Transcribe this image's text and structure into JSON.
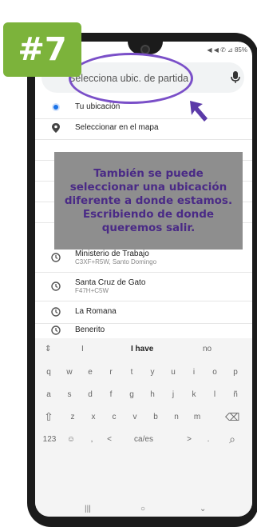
{
  "badge": "#7",
  "status": "◀ ◀ ✆ ⊿ 85%",
  "search": {
    "placeholder": "Selecciona ubic. de partida"
  },
  "rows": [
    {
      "title": "Tu ubicación",
      "sub": "",
      "icon": "location-dot-icon"
    },
    {
      "title": "Seleccionar en el mapa",
      "sub": "",
      "icon": "map-pin-icon"
    },
    {
      "title": "Ministerio de Trabajo",
      "sub": "C3XF+R5W, Santo Domingo",
      "icon": "history-icon"
    },
    {
      "title": "Santa Cruz de Gato",
      "sub": "F47H+C5W",
      "icon": "history-icon"
    },
    {
      "title": "La Romana",
      "sub": "",
      "icon": "history-icon"
    },
    {
      "title": "Benerito",
      "sub": "",
      "icon": "history-icon"
    }
  ],
  "overlay_text": "También se puede seleccionar una ubicación diferente a donde estamos. Escribiendo de donde queremos salir.",
  "keyboard": {
    "suggestions": [
      "⇕",
      "I",
      "I have",
      "no"
    ],
    "row1": [
      "q",
      "w",
      "e",
      "r",
      "t",
      "y",
      "u",
      "i",
      "o",
      "p"
    ],
    "row2": [
      "a",
      "s",
      "d",
      "f",
      "g",
      "h",
      "j",
      "k",
      "l",
      "ñ"
    ],
    "row3": [
      "⇧",
      "z",
      "x",
      "c",
      "v",
      "b",
      "n",
      "m",
      "⌫"
    ],
    "row4": [
      "123",
      "☺",
      ",",
      "<",
      "ca/es",
      ">",
      ".",
      "⌕"
    ],
    "nav": [
      "|||",
      "○",
      "⌄"
    ]
  }
}
